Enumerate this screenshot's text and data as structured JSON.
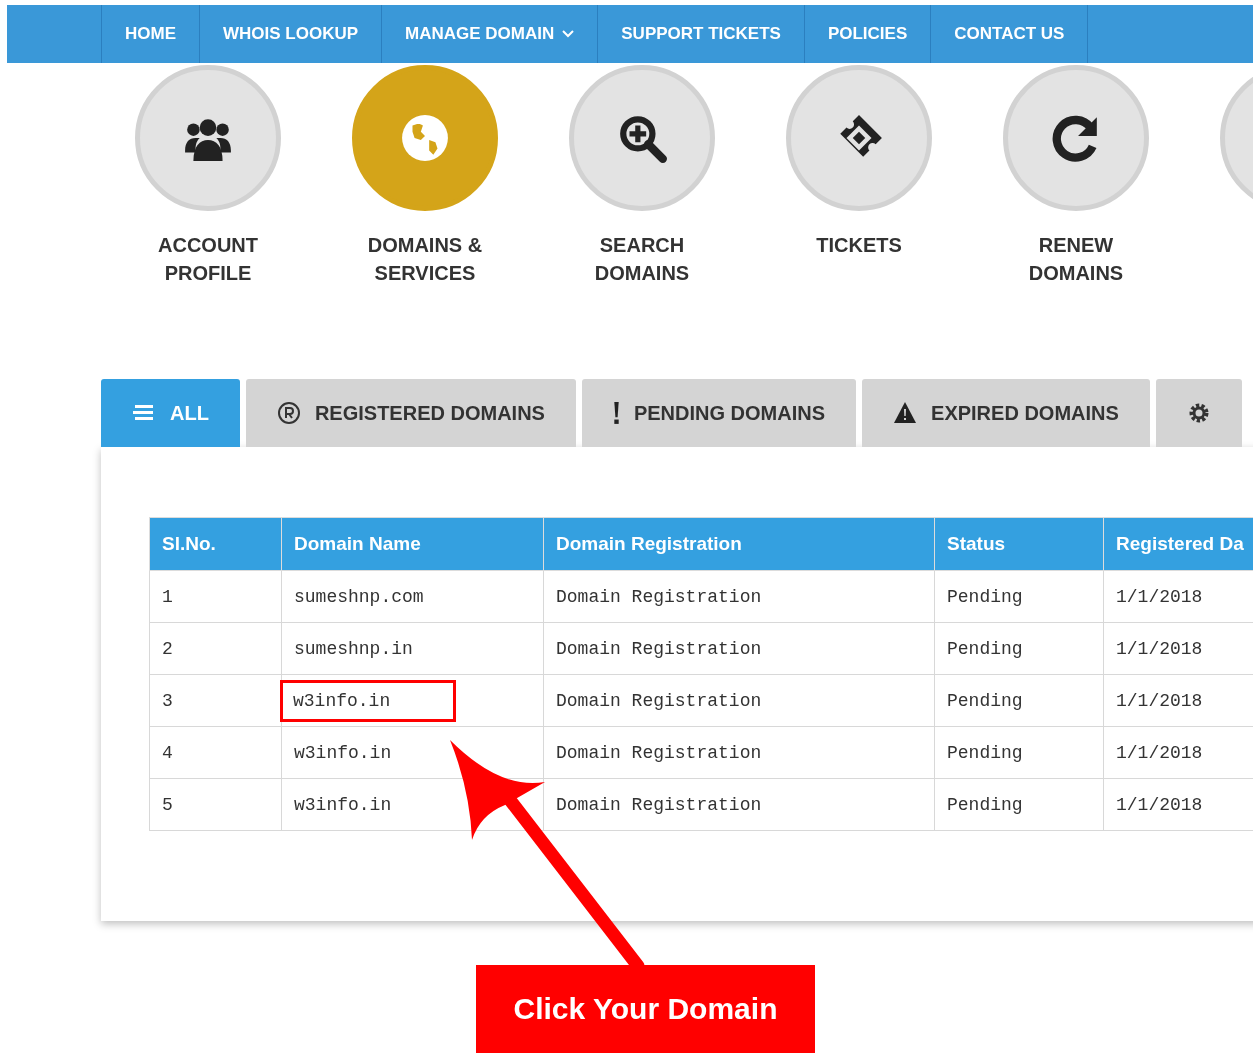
{
  "nav": [
    {
      "label": "HOME",
      "dropdown": false
    },
    {
      "label": "WHOIS LOOKUP",
      "dropdown": false
    },
    {
      "label": "MANAGE DOMAIN",
      "dropdown": true
    },
    {
      "label": "SUPPORT TICKETS",
      "dropdown": false
    },
    {
      "label": "POLICIES",
      "dropdown": false
    },
    {
      "label": "CONTACT US",
      "dropdown": false
    }
  ],
  "shortcuts": [
    {
      "label": "ACCOUNT PROFILE",
      "kind": "users",
      "selected": false
    },
    {
      "label": "DOMAINS & SERVICES",
      "kind": "globe",
      "selected": true
    },
    {
      "label": "SEARCH DOMAINS",
      "kind": "search-plus",
      "selected": false
    },
    {
      "label": "TICKETS",
      "kind": "ticket",
      "selected": false
    },
    {
      "label": "RENEW DOMAINS",
      "kind": "refresh",
      "selected": false
    },
    {
      "selected": false
    }
  ],
  "tabs": [
    {
      "label": "ALL",
      "kind": "list",
      "selected": true
    },
    {
      "label": "REGISTERED DOMAINS",
      "kind": "registered",
      "selected": false
    },
    {
      "label": "PENDING DOMAINS",
      "kind": "exclamation",
      "selected": false
    },
    {
      "label": "EXPIRED DOMAINS",
      "kind": "warning",
      "selected": false
    },
    {
      "kind": "gear",
      "selected": false
    }
  ],
  "table": {
    "columns": [
      "Sl.No.",
      "Domain Name",
      "Domain Registration",
      "Status",
      "Registered Da"
    ],
    "rows": [
      {
        "cells": [
          "1",
          "sumeshnp.com",
          "Domain Registration",
          "Pending",
          "1/1/2018"
        ],
        "highlighted": false
      },
      {
        "cells": [
          "2",
          "sumeshnp.in",
          "Domain Registration",
          "Pending",
          "1/1/2018"
        ],
        "highlighted": false
      },
      {
        "cells": [
          "3",
          "w3info.in",
          "Domain Registration",
          "Pending",
          "1/1/2018"
        ],
        "highlighted": true
      },
      {
        "cells": [
          "4",
          "w3info.in",
          "Domain Registration",
          "Pending",
          "1/1/2018"
        ],
        "highlighted": false
      },
      {
        "cells": [
          "5",
          "w3info.in",
          "Domain Registration",
          "Pending",
          "1/1/2018"
        ],
        "highlighted": false
      }
    ]
  },
  "callout": {
    "text": "Click Your Domain"
  }
}
